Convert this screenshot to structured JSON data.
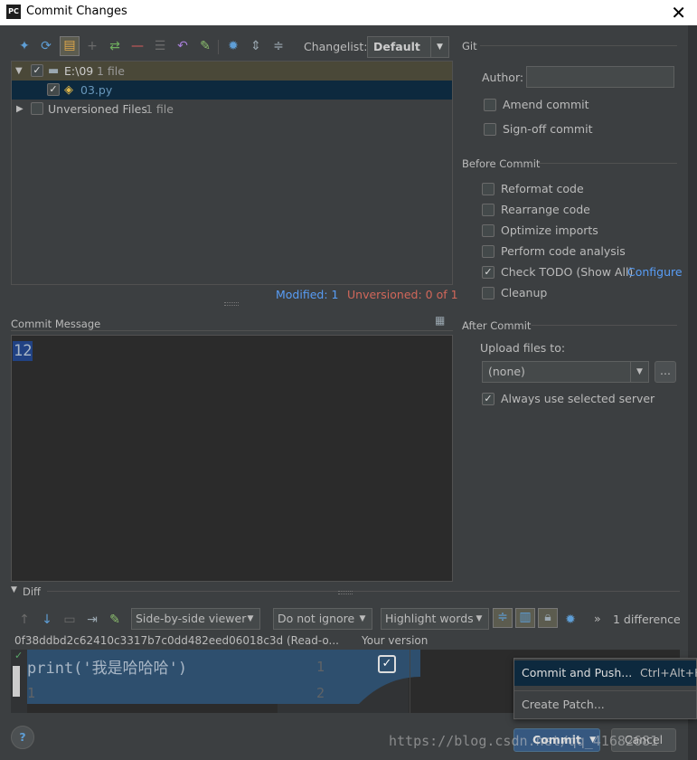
{
  "window": {
    "title": "Commit Changes",
    "app_icon": "PC"
  },
  "toolbar": {
    "icons": [
      "pin-icon",
      "refresh-icon",
      "group-by-directory-icon",
      "add-icon",
      "move-changelist-icon",
      "remove-icon",
      "diff-icon",
      "rollback-icon",
      "edit-icon",
      "settings-icon",
      "expand-all-icon",
      "collapse-all-icon"
    ],
    "changelist_label": "Changelist:",
    "changelist_value": "Default"
  },
  "tree": {
    "root_label": "E:\\09",
    "root_count": "1 file",
    "file_label": "03.py",
    "unversioned_label": "Unversioned Files",
    "unversioned_count": "1 file"
  },
  "status": {
    "modified": "Modified: 1",
    "unversioned": "Unversioned: 0 of 1"
  },
  "commit_message": {
    "label": "Commit Message",
    "text": "12"
  },
  "git": {
    "section": "Git",
    "author_label": "Author:",
    "author_value": "",
    "amend": "Amend commit",
    "signoff": "Sign-off commit"
  },
  "before_commit": {
    "section": "Before Commit",
    "items": [
      {
        "label": "Reformat code",
        "checked": false
      },
      {
        "label": "Rearrange code",
        "checked": false
      },
      {
        "label": "Optimize imports",
        "checked": false
      },
      {
        "label": "Perform code analysis",
        "checked": false
      },
      {
        "label": "Check TODO (Show All)",
        "checked": true
      },
      {
        "label": "Cleanup",
        "checked": false
      }
    ],
    "configure_link": "Configure"
  },
  "after_commit": {
    "section": "After Commit",
    "upload_label": "Upload files to:",
    "upload_value": "(none)",
    "browse": "...",
    "always_use": "Always use selected server"
  },
  "diff": {
    "section": "Diff",
    "viewer": "Side-by-side viewer",
    "ignore": "Do not ignore",
    "highlight": "Highlight words",
    "count": "1 difference",
    "left_title": "0f38ddbd2c62410c3317b7c0dd482eed06018c3d (Read-o...",
    "right_title": "Your version",
    "code_line": "print('我是哈哈哈')",
    "line1": "1",
    "line2": "1",
    "right_line1": "1",
    "right_line2": "2"
  },
  "popup": {
    "items": [
      {
        "label": "Commit and Push...",
        "shortcut": "Ctrl+Alt+K"
      },
      {
        "label": "Create Patch...",
        "shortcut": ""
      }
    ]
  },
  "buttons": {
    "commit": "Commit",
    "cancel": "Cancel",
    "help": "?"
  },
  "watermark": "https://blog.csdn.net/qq_41682681",
  "colors": {
    "background": "#3c3f41",
    "editor": "#2b2b2b",
    "selection": "#0d293e",
    "accent_link": "#589df6",
    "unversioned": "#d1675a",
    "root_row": "#4a4838"
  }
}
